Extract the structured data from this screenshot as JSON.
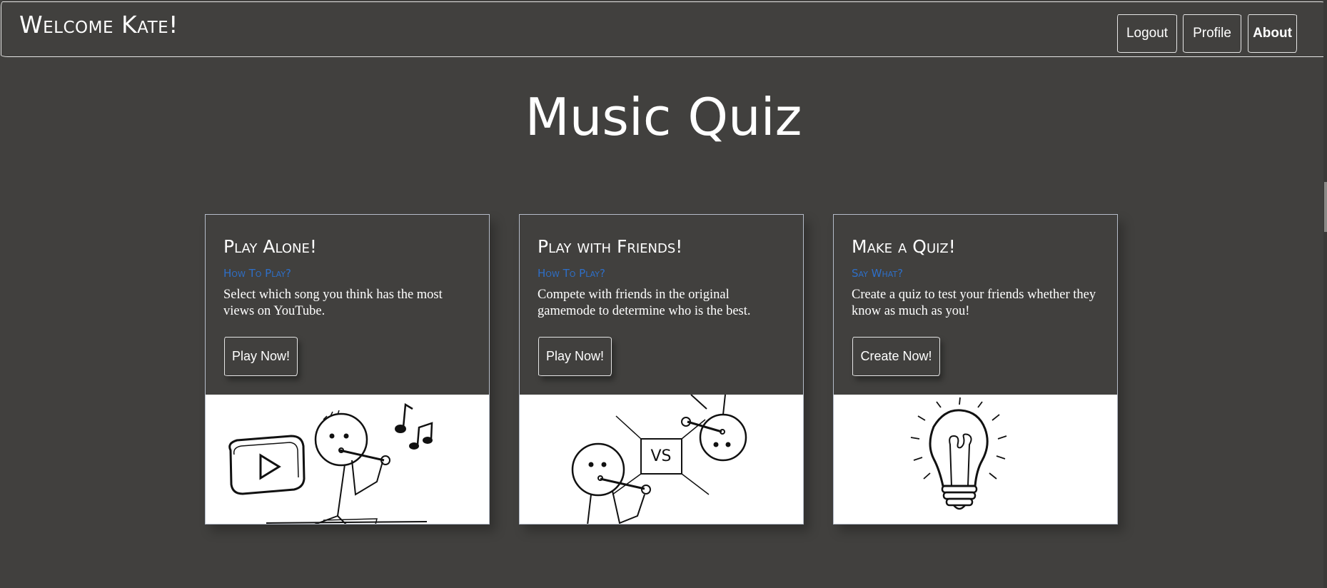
{
  "nav": {
    "brand": "Welcome Kate!",
    "buttons": [
      {
        "label": "Logout"
      },
      {
        "label": "Profile"
      },
      {
        "label": "About"
      }
    ]
  },
  "page_title": "Music Quiz",
  "cards": [
    {
      "title": "Play Alone!",
      "subtitle": "How To Play?",
      "text": "Select which song you think has the most views on YouTube.",
      "button": "Play Now!",
      "image_icon": "youtube-music-doodle-icon"
    },
    {
      "title": "Play with Friends!",
      "subtitle": "How To Play?",
      "text": "Compete with friends in the original gamemode to determine who is the best.",
      "button": "Play Now!",
      "image_icon": "versus-doodle-icon",
      "image_text": "VS"
    },
    {
      "title": "Make a Quiz!",
      "subtitle": "Say What?",
      "text": "Create a quiz to test your friends whether they know as much as you!",
      "button": "Create Now!",
      "image_icon": "lightbulb-doodle-icon"
    }
  ],
  "colors": {
    "background": "#41403e",
    "border": "#e6e6e6",
    "subtitle": "#2e6fc8",
    "card_border": "#b5bcc9"
  }
}
